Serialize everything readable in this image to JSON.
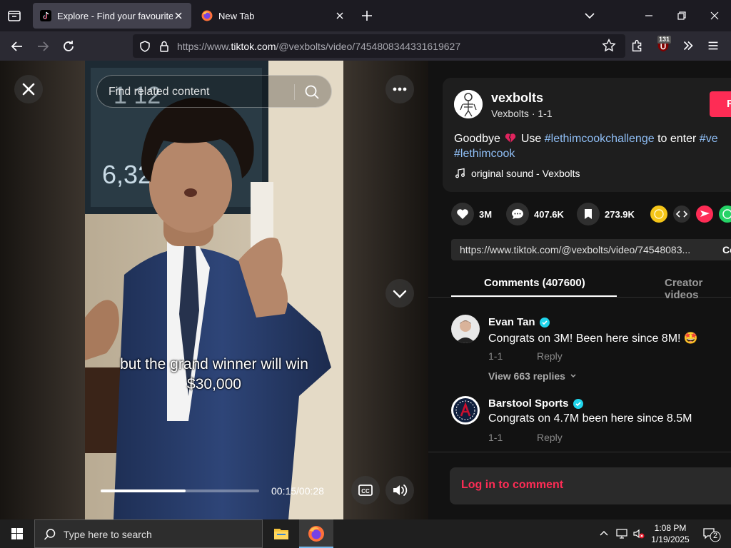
{
  "browser": {
    "tabs": [
      {
        "title": "Explore - Find your favourite vid",
        "active": true
      },
      {
        "title": "New Tab",
        "active": false
      }
    ],
    "url_prefix": "https://www.",
    "url_host": "tiktok.com",
    "url_path": "/@vexbolts/video/7454808344331619627",
    "extension_badge": "131"
  },
  "video": {
    "search_placeholder": "Find related content",
    "caption_line1": "but the grand winner will win",
    "caption_line2": "$30,000",
    "time": "00:15/00:28",
    "progress": 0.536
  },
  "author": {
    "username": "vexbolts",
    "nickname": "Vexbolts · 1-1",
    "follow_label": "F",
    "desc_goodbye": "Goodbye",
    "desc_use": "Use",
    "desc_tag1": "#lethimcookchallenge",
    "desc_to_enter": "to enter",
    "desc_tag2": "#ve",
    "desc_tag3": "#lethimcook",
    "music": "original sound - Vexbolts"
  },
  "actions": {
    "likes": "3M",
    "comments": "407.6K",
    "saves": "273.9K"
  },
  "share": {
    "link": "https://www.tiktok.com/@vexbolts/video/74548083...",
    "copy_label": "Co"
  },
  "tabs": {
    "comments": "Comments (407600)",
    "creator_videos": "Creator videos"
  },
  "comments": [
    {
      "name": "Evan Tan",
      "text": "Congrats on 3M! Been here since 8M! 🤩",
      "date": "1-1",
      "reply": "Reply",
      "view_replies": "View 663 replies"
    },
    {
      "name": "Barstool Sports",
      "text": "Congrats on 4.7M been here since 8.5M",
      "date": "1-1",
      "reply": "Reply"
    }
  ],
  "login_label": "Log in to comment",
  "taskbar": {
    "search_placeholder": "Type here to search",
    "time": "1:08 PM",
    "date": "1/19/2025",
    "notifications": "2"
  },
  "colors": {
    "accent": "#fe2c55",
    "hashtag": "#8fbef5"
  }
}
